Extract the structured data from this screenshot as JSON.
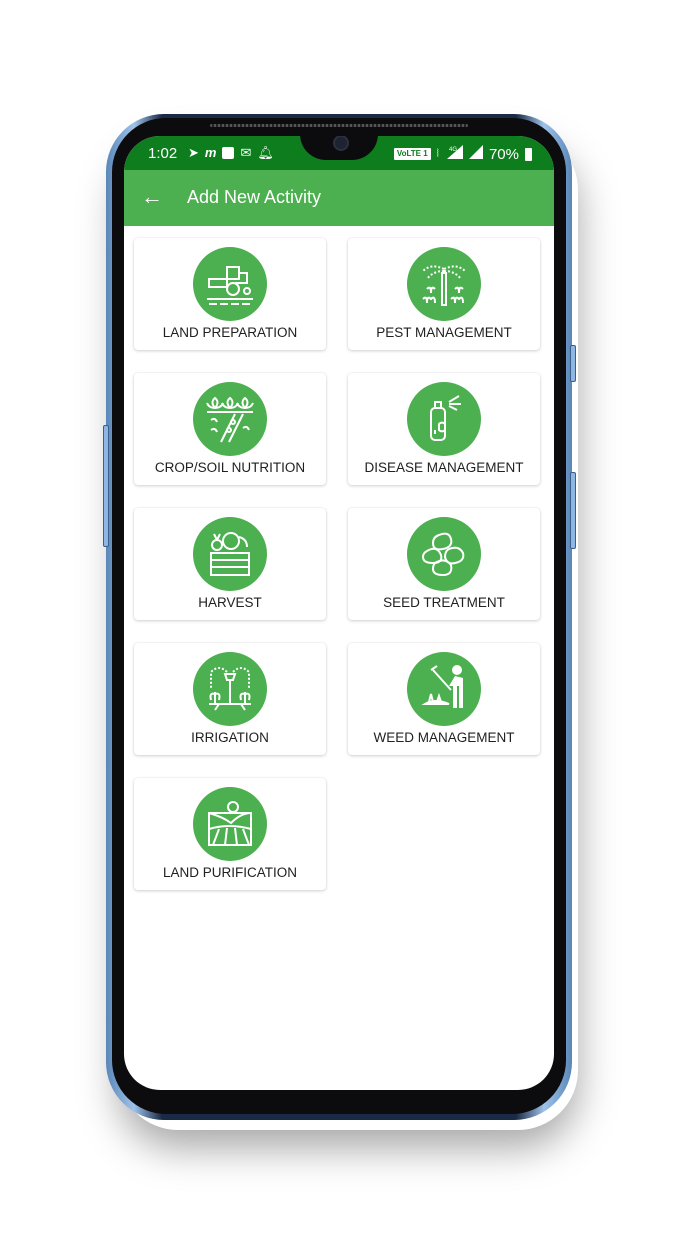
{
  "status_bar": {
    "time": "1:02",
    "left_icons": [
      "telegram-icon",
      "paytm-icon",
      "docs-icon",
      "mail-open-icon",
      "bell-icon"
    ],
    "volte_label": "VoLTE 1",
    "network_label": "4G",
    "battery": "70%"
  },
  "app_bar": {
    "title": "Add New Activity",
    "back_icon": "arrow-left-icon"
  },
  "activities": [
    {
      "label": "LAND PREPARATION",
      "icon": "tractor-icon"
    },
    {
      "label": "PEST MANAGEMENT",
      "icon": "sprinkler-plants-icon"
    },
    {
      "label": "CROP/SOIL NUTRITION",
      "icon": "crops-soil-icon"
    },
    {
      "label": "DISEASE MANAGEMENT",
      "icon": "spray-can-icon"
    },
    {
      "label": "HARVEST",
      "icon": "vegetable-crate-icon"
    },
    {
      "label": "SEED TREATMENT",
      "icon": "beans-icon"
    },
    {
      "label": "IRRIGATION",
      "icon": "irrigation-sprinkler-icon"
    },
    {
      "label": "WEED MANAGEMENT",
      "icon": "farmer-hoe-icon"
    },
    {
      "label": "LAND PURIFICATION",
      "icon": "field-sun-icon"
    }
  ],
  "colors": {
    "status_bar": "#0e7d1e",
    "app_bar": "#4caf50",
    "icon_bg": "#4caf50",
    "label_text": "#212121"
  }
}
